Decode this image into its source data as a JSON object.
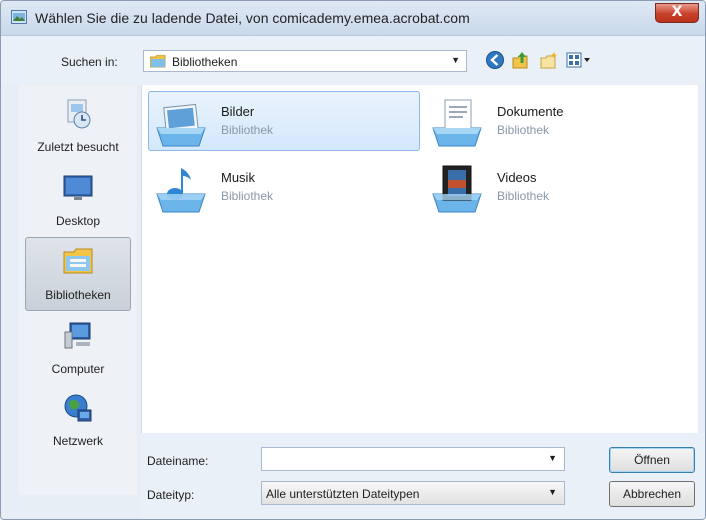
{
  "window": {
    "title": "Wählen Sie die zu ladende Datei, von comicademy.emea.acrobat.com",
    "close_label": "X"
  },
  "toolbar": {
    "lookin_label": "Suchen in:",
    "lookin_value": "Bibliotheken",
    "buttons": [
      "back-icon",
      "up-folder-icon",
      "new-folder-icon",
      "view-menu-icon"
    ]
  },
  "places": [
    {
      "label": "Zuletzt besucht",
      "icon": "recent-places-icon"
    },
    {
      "label": "Desktop",
      "icon": "desktop-icon"
    },
    {
      "label": "Bibliotheken",
      "icon": "libraries-icon",
      "selected": true
    },
    {
      "label": "Computer",
      "icon": "computer-icon"
    },
    {
      "label": "Netzwerk",
      "icon": "network-icon"
    }
  ],
  "items": [
    {
      "name": "Bilder",
      "type": "Bibliothek",
      "icon": "pictures-library-icon",
      "selected": true
    },
    {
      "name": "Dokumente",
      "type": "Bibliothek",
      "icon": "documents-library-icon"
    },
    {
      "name": "Musik",
      "type": "Bibliothek",
      "icon": "music-library-icon"
    },
    {
      "name": "Videos",
      "type": "Bibliothek",
      "icon": "videos-library-icon"
    }
  ],
  "bottom": {
    "filename_label": "Dateiname:",
    "filename_value": "",
    "filetype_label": "Dateityp:",
    "filetype_value": "Alle unterstützten Dateitypen",
    "open_label": "Öffnen",
    "cancel_label": "Abbrechen"
  },
  "colors": {
    "selection_fill": "#d5e8fb",
    "selection_border": "#8db8e5",
    "title_close_red": "#c8412b",
    "library_icon_blue": "#5aa4dc"
  }
}
